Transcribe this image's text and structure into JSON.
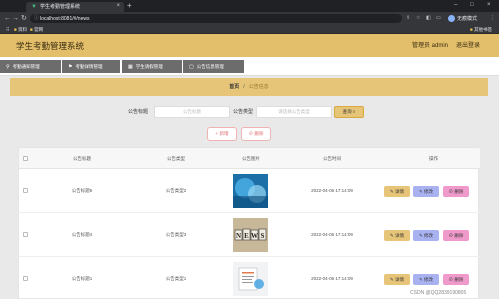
{
  "browser": {
    "tab_title": "学生考勤管理系统",
    "url": "localhost:8081/#/news",
    "profile_label": "无痕模式",
    "bookmarks": [
      "资料",
      "官网"
    ],
    "bookmarks_right": "其他书签"
  },
  "header": {
    "title": "学生考勤管理系统",
    "admin": "管理员 admin",
    "logout": "退出登录"
  },
  "menu": [
    {
      "label": "考勤通知管理",
      "icon": "pin-icon"
    },
    {
      "label": "考勤详情管理",
      "icon": "flag-icon"
    },
    {
      "label": "学生请假管理",
      "icon": "grid-icon"
    },
    {
      "label": "公告信息管理",
      "icon": "folder-icon"
    }
  ],
  "breadcrumb": {
    "home": "首页",
    "separator": "/",
    "current": "公告信息"
  },
  "search": {
    "title_label": "公告标题",
    "title_placeholder": "公告标题",
    "type_label": "公告类型",
    "type_placeholder": "请选择公告类型",
    "search_button": "查询"
  },
  "actions": {
    "add": "新增",
    "delete": "删除"
  },
  "table": {
    "headers": [
      "公告标题",
      "公告类型",
      "公告图片",
      "公告时间",
      "操作"
    ],
    "rows": [
      {
        "title": "公告标题5",
        "type": "公告类型2",
        "image": "blue-abstract-photo",
        "time": "2022-04-06 17:14:09"
      },
      {
        "title": "公告标题4",
        "type": "公告类型3",
        "image": "news-blocks-photo",
        "time": "2022-04-06 17:14:09"
      },
      {
        "title": "公告标题1",
        "type": "公告类型1",
        "image": "document-photo",
        "time": "2022-04-06 17:14:09"
      }
    ],
    "row_buttons": {
      "detail": "详情",
      "edit": "修改",
      "delete": "删除"
    }
  },
  "watermark": "CSDN @QQ2839190805",
  "colors": {
    "accent": "#e3bf6b",
    "edit": "#a9b2f0",
    "delete": "#f09acb",
    "menu": "#6c6c6c"
  }
}
